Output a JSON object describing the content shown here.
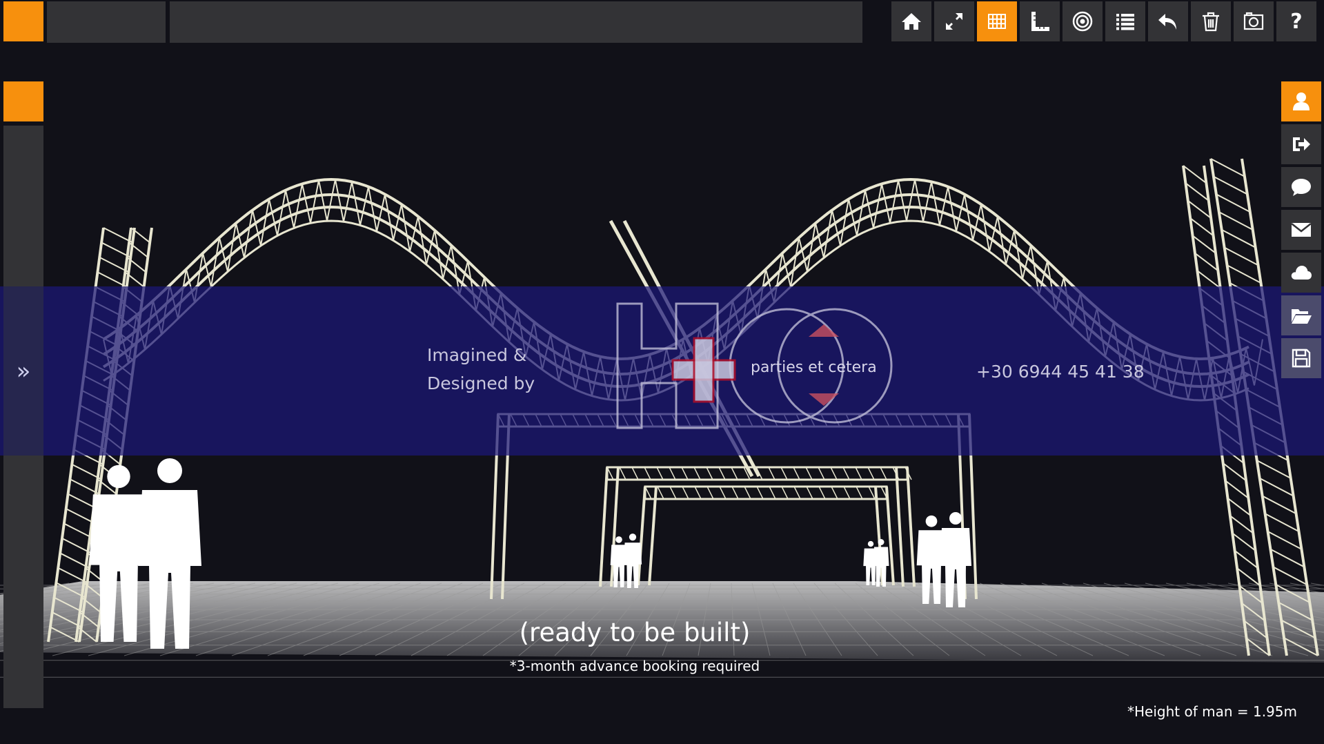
{
  "toolbar": {
    "buttons": [
      {
        "name": "home-icon",
        "active": false
      },
      {
        "name": "fullscreen-icon",
        "active": false
      },
      {
        "name": "grid-icon",
        "active": true
      },
      {
        "name": "measure-icon",
        "active": false
      },
      {
        "name": "target-icon",
        "active": false
      },
      {
        "name": "list-icon",
        "active": false
      },
      {
        "name": "undo-icon",
        "active": false
      },
      {
        "name": "trash-icon",
        "active": false
      },
      {
        "name": "screenshot-icon",
        "active": false
      },
      {
        "name": "help-icon",
        "active": false
      }
    ],
    "help_label": "?"
  },
  "right_panel": {
    "buttons": [
      {
        "name": "user-icon",
        "active": true
      },
      {
        "name": "logout-icon",
        "active": false
      },
      {
        "name": "chat-icon",
        "active": false
      },
      {
        "name": "mail-icon",
        "active": false
      },
      {
        "name": "cloud-icon",
        "active": false
      },
      {
        "name": "folder-open-icon",
        "active": false
      },
      {
        "name": "save-icon",
        "active": false
      }
    ]
  },
  "left_panel": {
    "expand_label": "»"
  },
  "watermark": {
    "line1": "Imagined &",
    "line2": "Designed by",
    "brand": "parties et cetera",
    "phone": "+30 6944 45 41 38"
  },
  "captions": {
    "ready": "(ready to be built)",
    "booking": "*3-month advance booking required",
    "height_note": "*Height of man = 1.95m"
  },
  "colors": {
    "accent": "#f7900d",
    "panel": "#333336",
    "background": "#111118",
    "band": "#1c1878",
    "truss": "#e8e6d0"
  }
}
